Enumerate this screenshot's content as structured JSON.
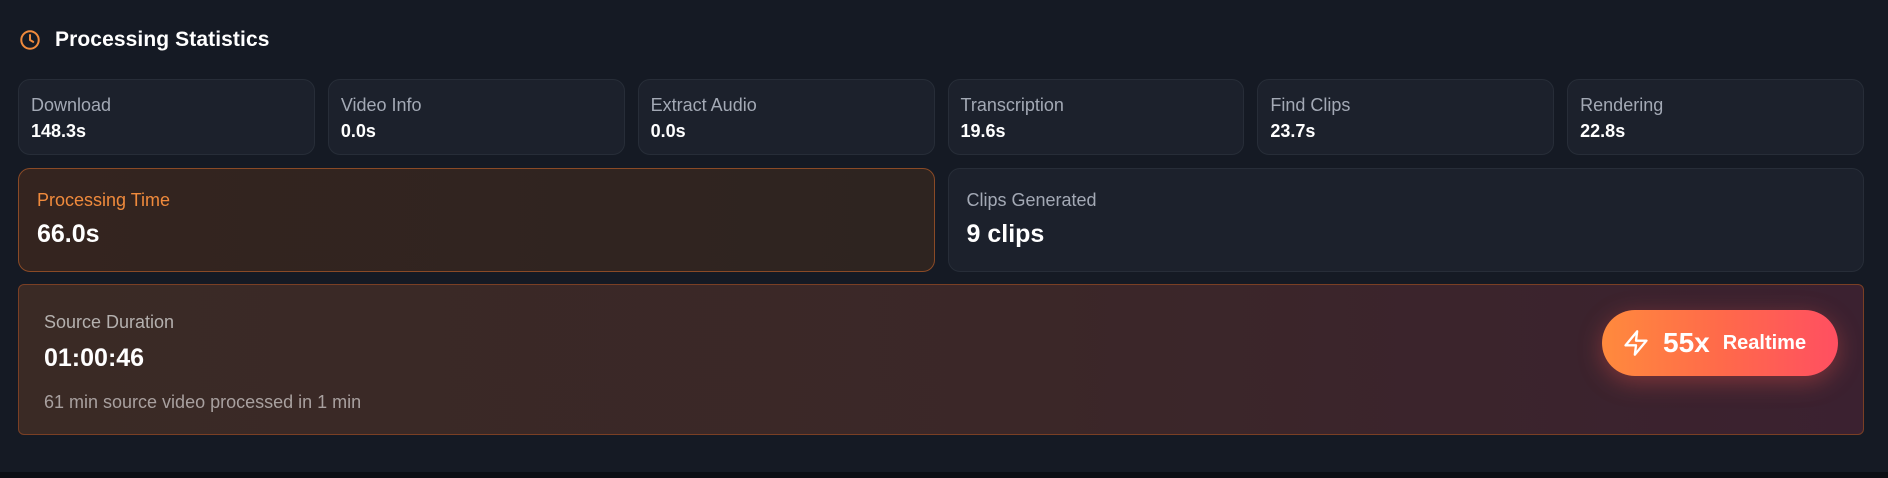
{
  "header": {
    "title": "Processing Statistics",
    "icon": "clock-icon",
    "accent_color": "#f08a3c"
  },
  "stages": [
    {
      "label": "Download",
      "value": "148.3s"
    },
    {
      "label": "Video Info",
      "value": "0.0s"
    },
    {
      "label": "Extract Audio",
      "value": "0.0s"
    },
    {
      "label": "Transcription",
      "value": "19.6s"
    },
    {
      "label": "Find Clips",
      "value": "23.7s"
    },
    {
      "label": "Rendering",
      "value": "22.8s"
    }
  ],
  "processing_time": {
    "label": "Processing Time",
    "value": "66.0s"
  },
  "clips_generated": {
    "label": "Clips Generated",
    "value": "9 clips"
  },
  "source": {
    "label": "Source Duration",
    "value": "01:00:46",
    "description": "61 min source video processed in 1 min"
  },
  "speed_badge": {
    "icon": "lightning-icon",
    "value": "55x",
    "label": "Realtime"
  }
}
